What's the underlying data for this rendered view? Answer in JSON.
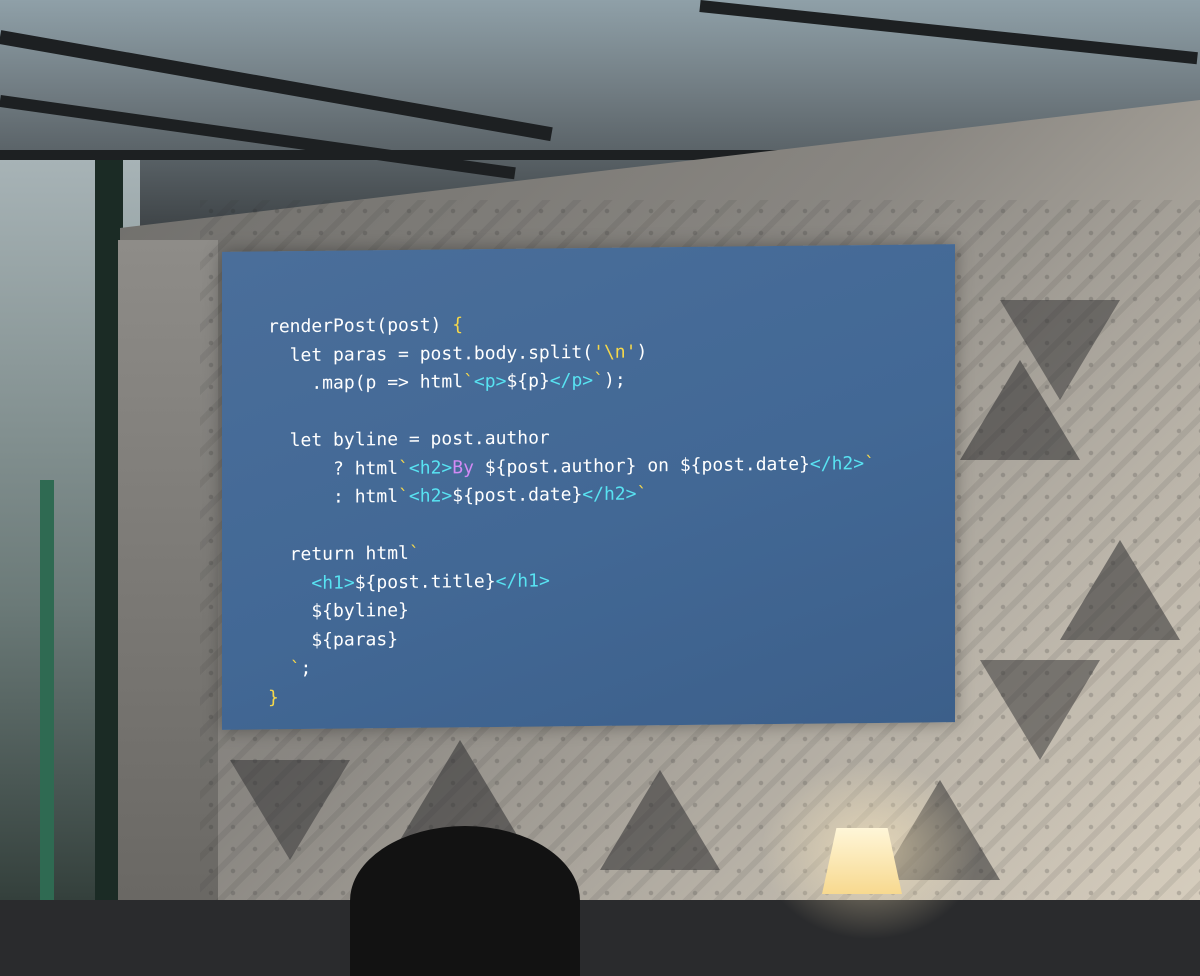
{
  "slide": {
    "code_lines": [
      [
        {
          "t": "renderPost(post) ",
          "c": "white"
        },
        {
          "t": "{",
          "c": "yellow"
        }
      ],
      [
        {
          "t": "  let paras = post.body.split(",
          "c": "white"
        },
        {
          "t": "'\\n'",
          "c": "yellow"
        },
        {
          "t": ")",
          "c": "white"
        }
      ],
      [
        {
          "t": "    .map(p => html",
          "c": "white"
        },
        {
          "t": "`",
          "c": "yellow"
        },
        {
          "t": "<p>",
          "c": "cyan"
        },
        {
          "t": "${p}",
          "c": "white"
        },
        {
          "t": "</p>",
          "c": "cyan"
        },
        {
          "t": "`",
          "c": "yellow"
        },
        {
          "t": ");",
          "c": "white"
        }
      ],
      [
        {
          "t": "",
          "c": "white"
        }
      ],
      [
        {
          "t": "  let byline = post.author",
          "c": "white"
        }
      ],
      [
        {
          "t": "      ? html",
          "c": "white"
        },
        {
          "t": "`",
          "c": "yellow"
        },
        {
          "t": "<h2>",
          "c": "cyan"
        },
        {
          "t": "By ",
          "c": "purple"
        },
        {
          "t": "${post.author}",
          "c": "white"
        },
        {
          "t": " on ",
          "c": "white"
        },
        {
          "t": "${post.date}",
          "c": "white"
        },
        {
          "t": "</h2>",
          "c": "cyan"
        },
        {
          "t": "`",
          "c": "yellow"
        }
      ],
      [
        {
          "t": "      : html",
          "c": "white"
        },
        {
          "t": "`",
          "c": "yellow"
        },
        {
          "t": "<h2>",
          "c": "cyan"
        },
        {
          "t": "${post.date}",
          "c": "white"
        },
        {
          "t": "</h2>",
          "c": "cyan"
        },
        {
          "t": "`",
          "c": "yellow"
        }
      ],
      [
        {
          "t": "",
          "c": "white"
        }
      ],
      [
        {
          "t": "  return html",
          "c": "white"
        },
        {
          "t": "`",
          "c": "yellow"
        }
      ],
      [
        {
          "t": "    ",
          "c": "white"
        },
        {
          "t": "<h1>",
          "c": "cyan"
        },
        {
          "t": "${post.title}",
          "c": "white"
        },
        {
          "t": "</h1>",
          "c": "cyan"
        }
      ],
      [
        {
          "t": "    ${byline}",
          "c": "white"
        }
      ],
      [
        {
          "t": "    ${paras}",
          "c": "white"
        }
      ],
      [
        {
          "t": "  ",
          "c": "white"
        },
        {
          "t": "`",
          "c": "yellow"
        },
        {
          "t": ";",
          "c": "white"
        }
      ],
      [
        {
          "t": "}",
          "c": "yellow"
        }
      ]
    ]
  },
  "colors": {
    "slide_bg": "#426895",
    "yellow": "#f6d84a",
    "cyan": "#58e3f2",
    "purple": "#d38af5",
    "white": "#ffffff"
  }
}
